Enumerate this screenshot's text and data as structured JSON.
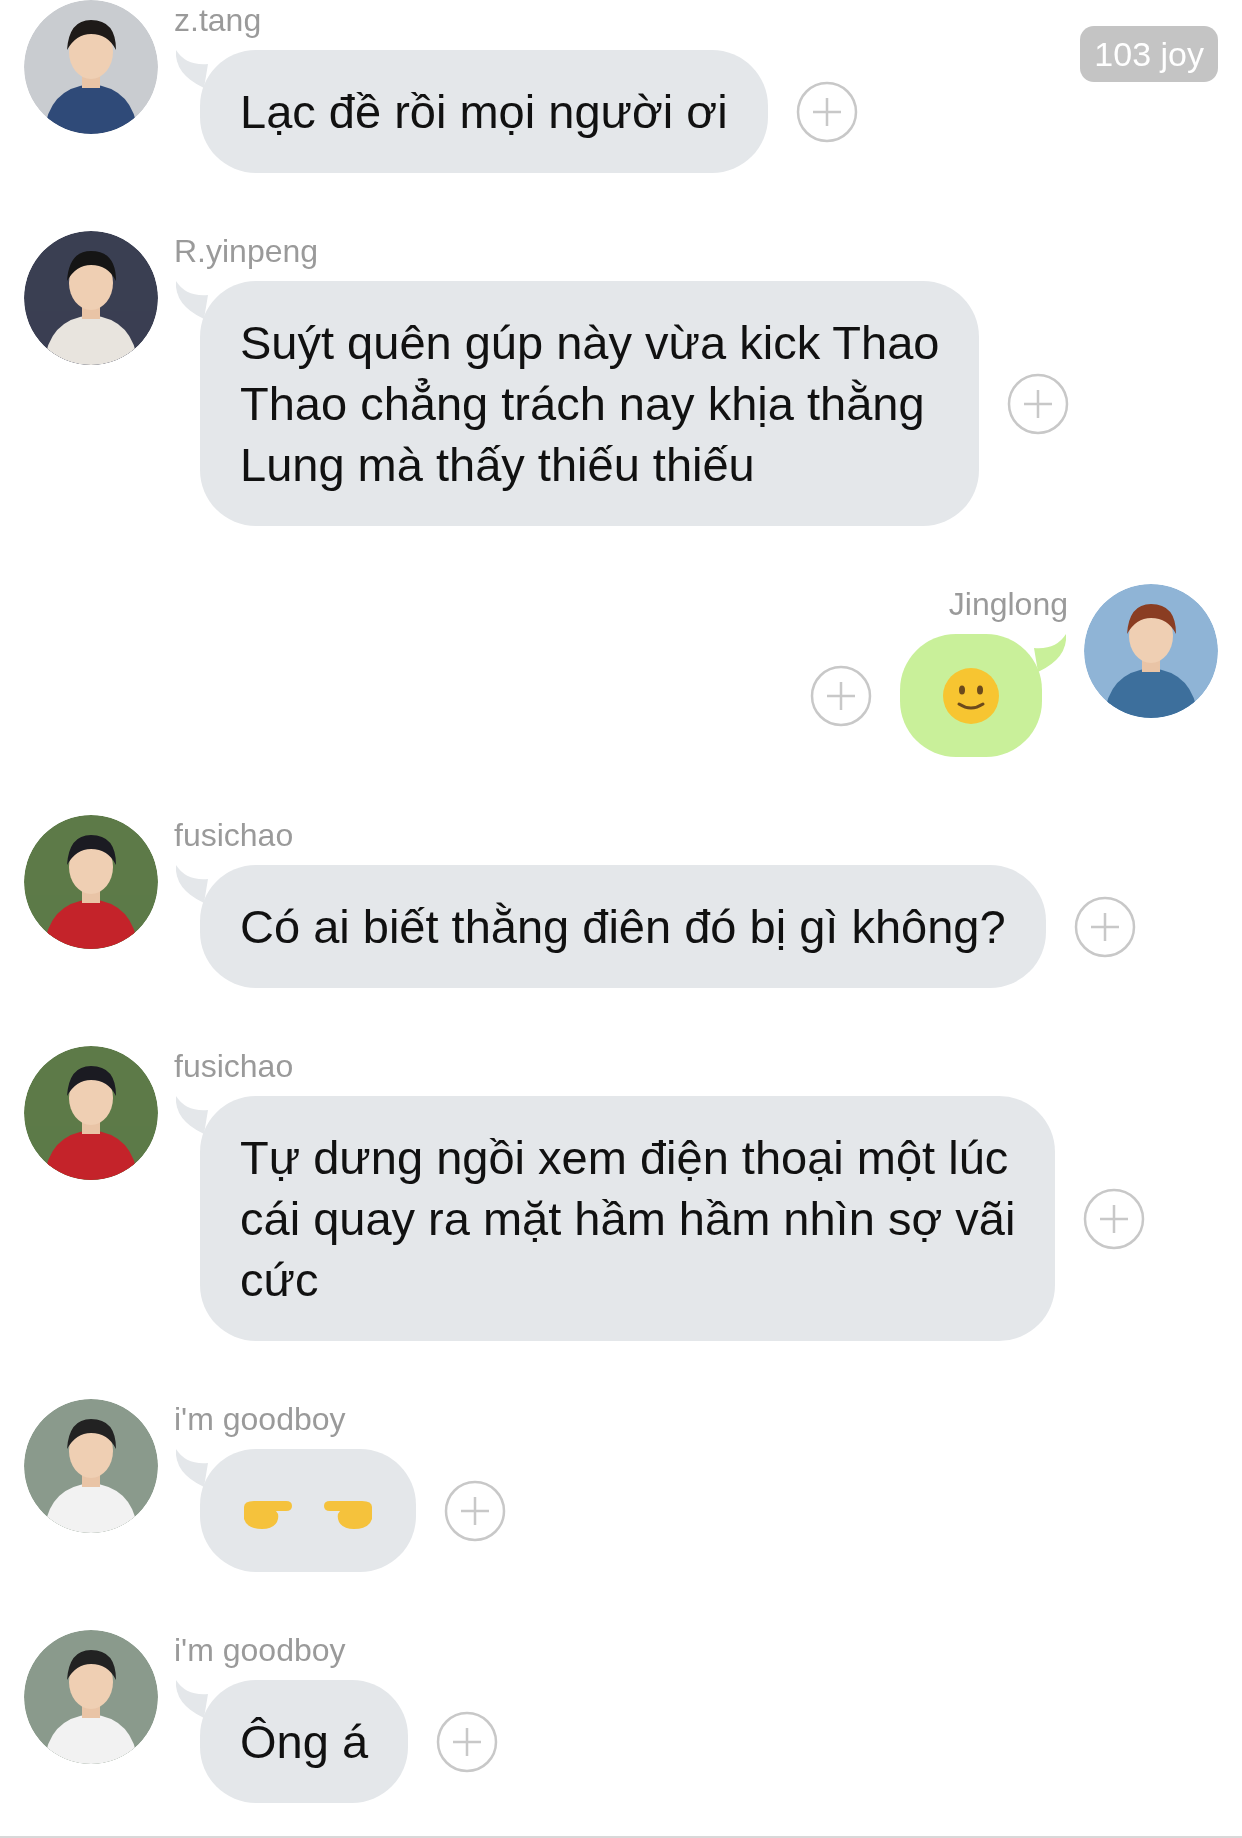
{
  "badge": "103 joy",
  "messages": [
    {
      "sender": "z.tang",
      "outgoing": false,
      "kind": "text",
      "lines": [
        "Lạc đề rồi mọi người ơi"
      ]
    },
    {
      "sender": "R.yinpeng",
      "outgoing": false,
      "kind": "text",
      "lines": [
        "Suýt quên gúp này vừa kick Thao",
        "Thao chẳng trách nay khịa thằng",
        "Lung mà thấy thiếu thiếu"
      ]
    },
    {
      "sender": "Jinglong",
      "outgoing": true,
      "kind": "smiley"
    },
    {
      "sender": "fusichao",
      "outgoing": false,
      "kind": "text",
      "lines": [
        "Có ai biết thằng điên đó bị gì không?"
      ]
    },
    {
      "sender": "fusichao",
      "outgoing": false,
      "kind": "text",
      "lines": [
        "Tự dưng ngồi xem điện thoại một lúc",
        "cái quay ra mặt hầm hầm nhìn sợ vãi",
        "cức"
      ]
    },
    {
      "sender": "i'm goodboy",
      "outgoing": false,
      "kind": "pointing-hands"
    },
    {
      "sender": "i'm goodboy",
      "outgoing": false,
      "kind": "text",
      "lines": [
        "Ông á"
      ]
    }
  ]
}
